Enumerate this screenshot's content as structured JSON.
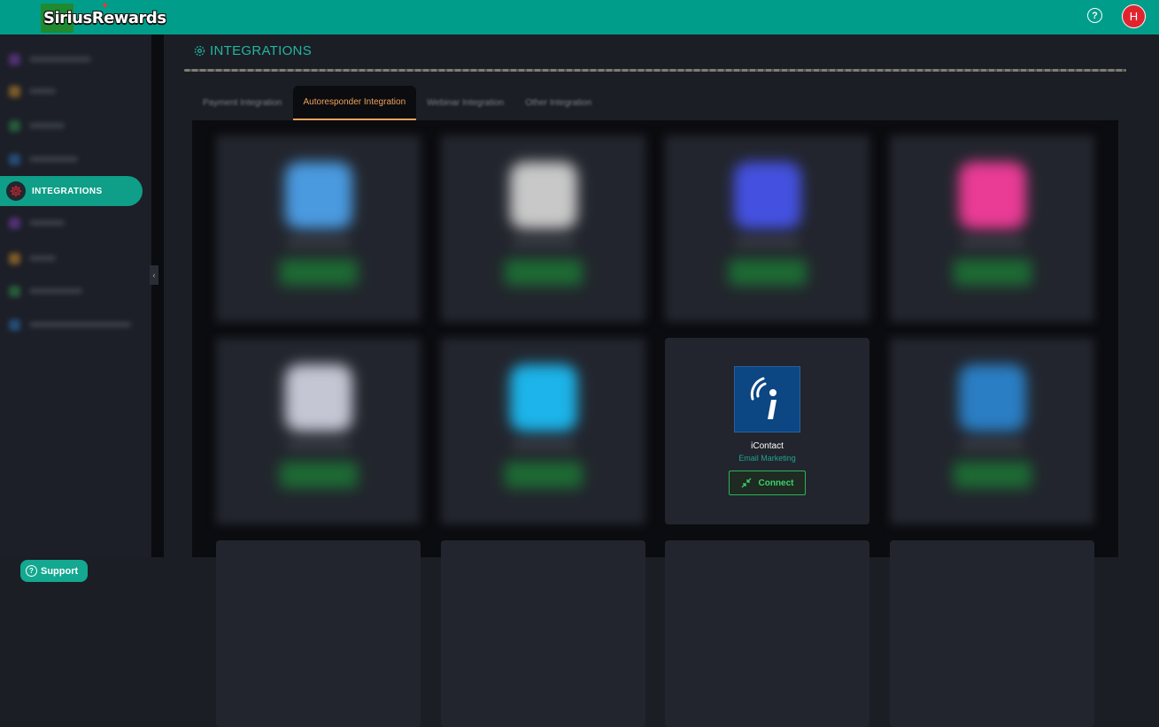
{
  "header": {
    "logo_text": "SiriusRewards",
    "help_icon": "question-circle-icon",
    "avatar_initial": "H"
  },
  "sidebar": {
    "active_item": {
      "label": "INTEGRATIONS",
      "icon": "gear-icon"
    },
    "blurred_item_count": 8,
    "support_label": "Support"
  },
  "main": {
    "title": "INTEGRATIONS",
    "title_icon": "gear-icon",
    "tabs": [
      {
        "label": "Payment Integration",
        "active": false
      },
      {
        "label": "Autoresponder Integration",
        "active": true
      },
      {
        "label": "Webinar Integration",
        "active": false
      },
      {
        "label": "Other Integration",
        "active": false
      }
    ],
    "visible_card": {
      "name": "iContact",
      "category": "Email Marketing",
      "button_label": "Connect"
    }
  },
  "colors": {
    "header_bg": "#009e8a",
    "accent_teal": "#0f9e87",
    "tab_active": "#f0a15a",
    "connect_green": "#3bd16c",
    "avatar_red": "#e0242f",
    "icontact_blue": "#0c4683"
  }
}
